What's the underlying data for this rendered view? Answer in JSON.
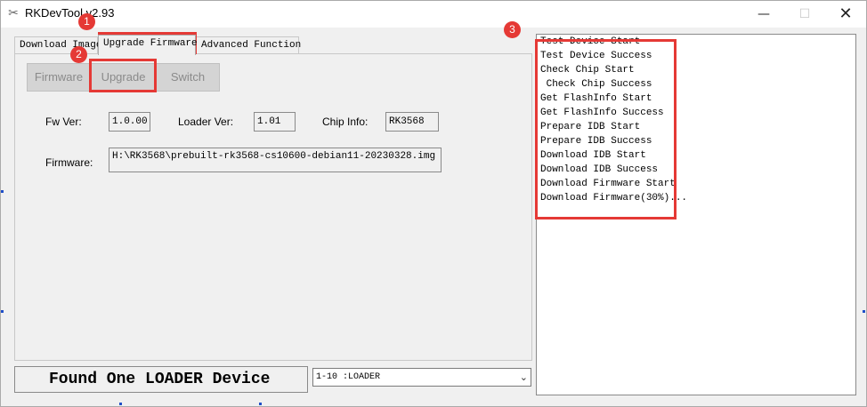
{
  "window": {
    "title": "RKDevTool v2.93",
    "minimize_glyph": "—",
    "maximize_glyph": "☐",
    "close_glyph": "✕",
    "app_icon": "tools-icon"
  },
  "tabs": [
    {
      "label": "Download Image",
      "active": false
    },
    {
      "label": "Upgrade Firmware",
      "active": true
    },
    {
      "label": "Advanced Function",
      "active": false
    }
  ],
  "toolbar": {
    "firmware_label": "Firmware",
    "upgrade_label": "Upgrade",
    "switch_label": "Switch"
  },
  "info": {
    "fw_ver_label": "Fw Ver:",
    "fw_ver_value": "1.0.00",
    "loader_ver_label": "Loader Ver:",
    "loader_ver_value": "1.01",
    "chip_info_label": "Chip Info:",
    "chip_info_value": "RK3568",
    "firmware_label": "Firmware:",
    "firmware_path": "H:\\RK3568\\prebuilt-rk3568-cs10600-debian11-20230328.img"
  },
  "status": {
    "text": "Found One LOADER Device"
  },
  "device_select": {
    "value": "1-10 :LOADER"
  },
  "log": [
    "Test Device Start",
    "Test Device Success",
    "Check Chip Start",
    " Check Chip Success",
    "Get FlashInfo Start",
    "Get FlashInfo Success",
    "Prepare IDB Start",
    "Prepare IDB Success",
    "Download IDB Start",
    "Download IDB Success",
    "Download Firmware Start",
    "Download Firmware(30%)..."
  ],
  "callouts": {
    "one": "1",
    "two": "2",
    "three": "3"
  },
  "colors": {
    "callout": "#e53935",
    "disabled_button": "#d4d4d4"
  }
}
